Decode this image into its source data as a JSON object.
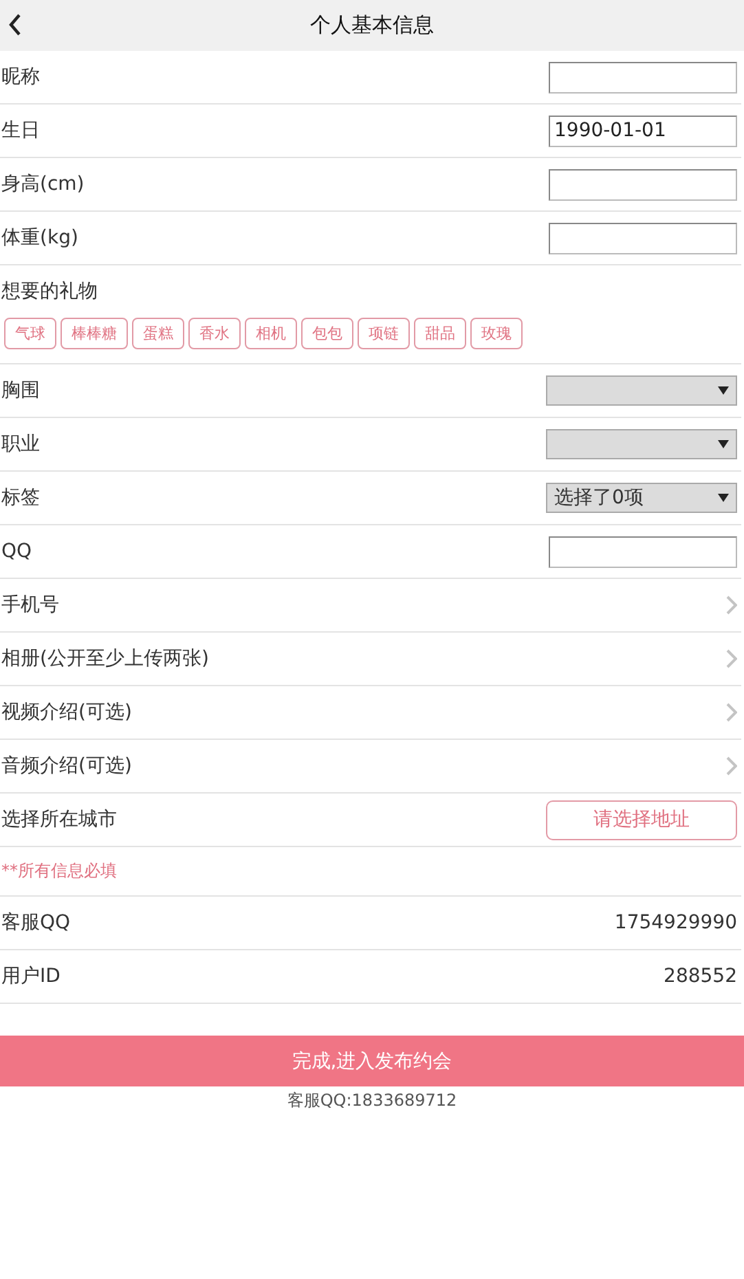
{
  "header": {
    "title": "个人基本信息"
  },
  "rows": [
    {
      "kind": "input",
      "label": "昵称"
    },
    {
      "kind": "input",
      "label": "生日",
      "value": "1990-01-01"
    },
    {
      "kind": "input",
      "label": "身高(cm)"
    },
    {
      "kind": "input",
      "label": "体重(kg)"
    },
    {
      "kind": "gifts",
      "label": "想要的礼物",
      "tags": [
        "气球",
        "棒棒糖",
        "蛋糕",
        "香水",
        "相机",
        "包包",
        "项链",
        "甜品",
        "玫瑰"
      ]
    },
    {
      "kind": "select",
      "label": "胸围"
    },
    {
      "kind": "select",
      "label": "职业"
    },
    {
      "kind": "select",
      "label": "标签",
      "value": "选择了0项"
    },
    {
      "kind": "input",
      "label": "QQ"
    },
    {
      "kind": "link",
      "label": "手机号"
    },
    {
      "kind": "link",
      "label": "相册(公开至少上传两张)"
    },
    {
      "kind": "link",
      "label": "视频介绍(可选)"
    },
    {
      "kind": "link",
      "label": "音频介绍(可选)"
    },
    {
      "kind": "button",
      "label": "选择所在城市",
      "button": "请选择地址"
    },
    {
      "kind": "note",
      "label": "**所有信息必填"
    },
    {
      "kind": "info",
      "label": "客服QQ",
      "value": "1754929990"
    },
    {
      "kind": "info",
      "label": "用户ID",
      "value": "288552"
    }
  ],
  "submit": "完成,进入发布约会",
  "footer": "客服QQ:1833689712"
}
